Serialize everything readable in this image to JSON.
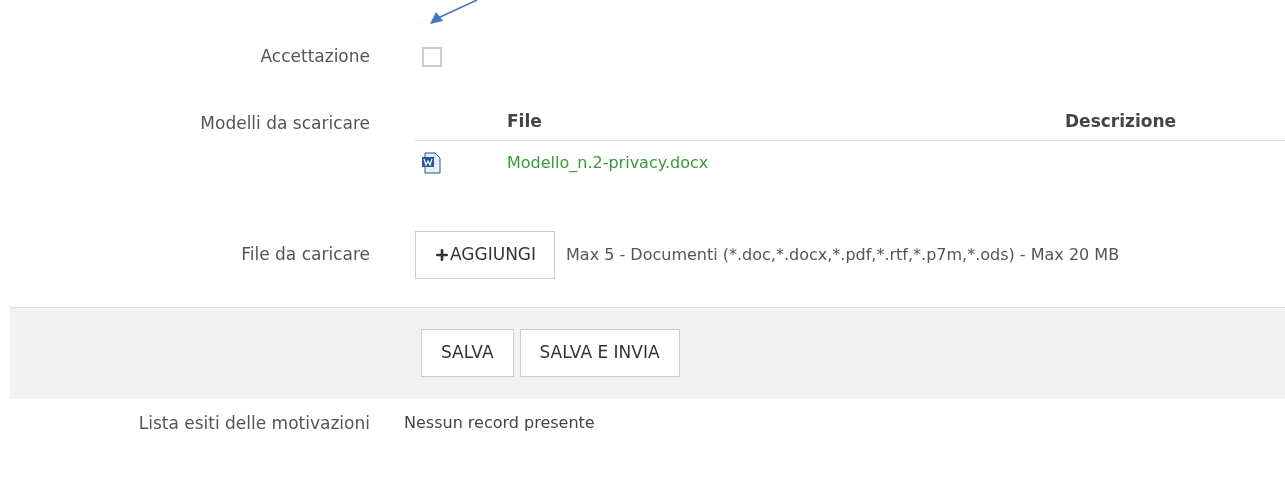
{
  "acceptance": {
    "label": "Accettazione",
    "checked": false
  },
  "templates": {
    "label": "Modelli da scaricare",
    "columns": [
      "File",
      "Descrizione"
    ],
    "rows": [
      {
        "file": "Modello_n.2-privacy.docx"
      }
    ]
  },
  "upload": {
    "label": "File da caricare",
    "button": "AGGIUNGI",
    "hint": "Max 5 - Documenti (*.doc,*.docx,*.pdf,*.rtf,*.p7m,*.ods) - Max 20 MB"
  },
  "actions": [
    "SALVA",
    "SALVA E INVIA"
  ],
  "outcomes": {
    "label": "Lista esiti delle motivazioni",
    "value": "Nessun record presente"
  }
}
